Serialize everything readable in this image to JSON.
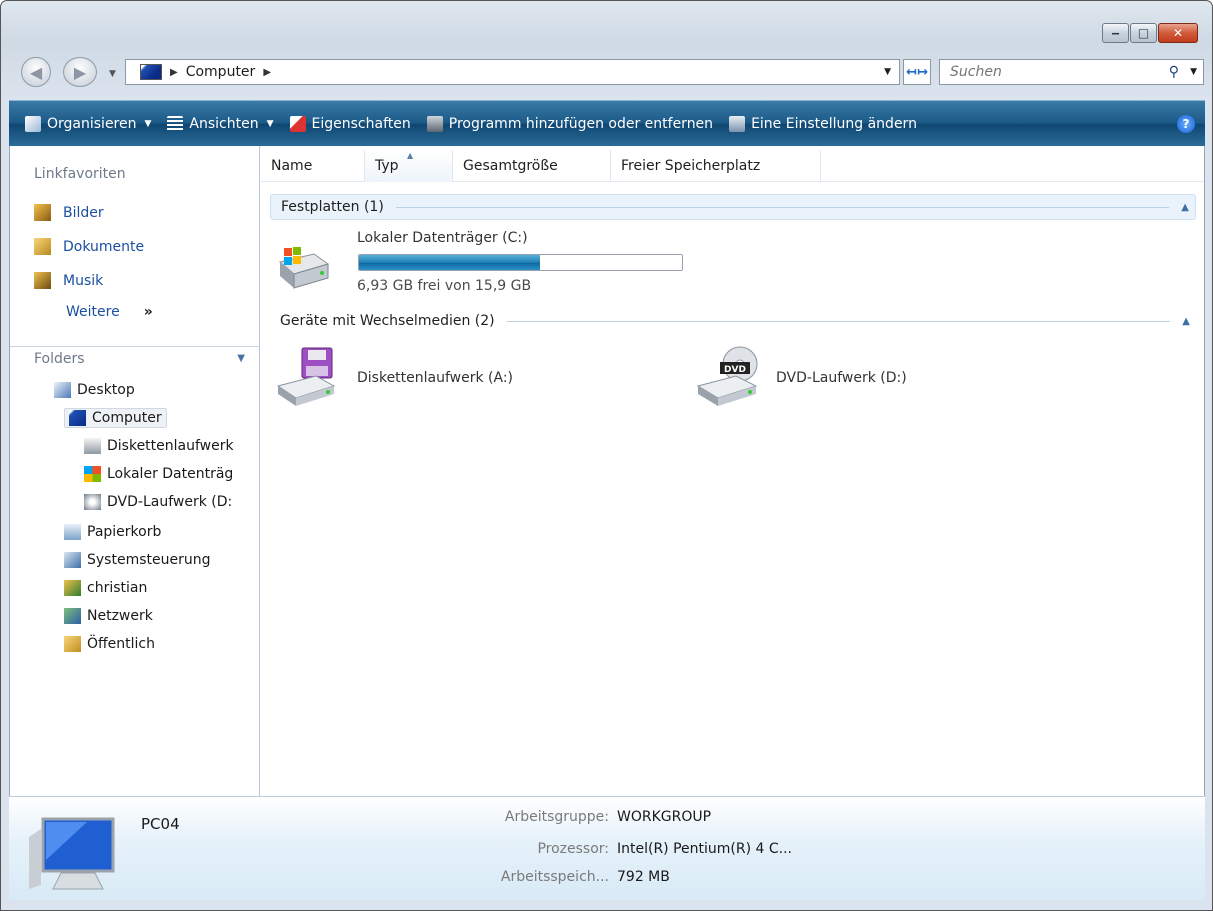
{
  "window": {
    "caption_buttons": {
      "minimize": "‒",
      "maximize": "□",
      "close": "✕"
    }
  },
  "address": {
    "crumbs": [
      "Computer"
    ],
    "search_placeholder": "Suchen"
  },
  "toolbar": {
    "organize": "Organisieren",
    "views": "Ansichten",
    "properties": "Eigenschaften",
    "programs": "Programm hinzufügen oder entfernen",
    "settings": "Eine Einstellung ändern",
    "help": "?"
  },
  "nav": {
    "links_title": "Linkfavoriten",
    "links": [
      "Bilder",
      "Dokumente",
      "Musik"
    ],
    "more": "Weitere",
    "more_chevron": "»",
    "folders_title": "Folders",
    "tree": [
      "Desktop",
      "Computer",
      "Diskettenlaufwerk",
      "Lokaler Datenträg",
      "DVD-Laufwerk (D:",
      "Papierkorb",
      "Systemsteuerung",
      "christian",
      "Netzwerk",
      "Öffentlich"
    ]
  },
  "columns": [
    "Name",
    "Typ",
    "Gesamtgröße",
    "Freier Speicherplatz"
  ],
  "groups": {
    "hard_disks": "Festplatten (1)",
    "removable": "Geräte mit Wechselmedien (2)"
  },
  "drives": {
    "c_name": "Lokaler Datenträger (C:)",
    "c_free_text": "6,93 GB frei von 15,9 GB",
    "c_used_fraction": 0.56,
    "a_name": "Diskettenlaufwerk (A:)",
    "d_name": "DVD-Laufwerk (D:)",
    "dvd_badge": "DVD"
  },
  "details": {
    "computer_name": "PC04",
    "workgroup_label": "Arbeitsgruppe:",
    "workgroup_value": "WORKGROUP",
    "cpu_label": "Prozessor:",
    "cpu_value": "Intel(R) Pentium(R) 4 C...",
    "ram_label": "Arbeitsspeich...",
    "ram_value": "792 MB"
  },
  "colors": {
    "toolbar": "#1c5a88",
    "link": "#1b4fa0",
    "bar_fill": "#1f7fb6"
  }
}
